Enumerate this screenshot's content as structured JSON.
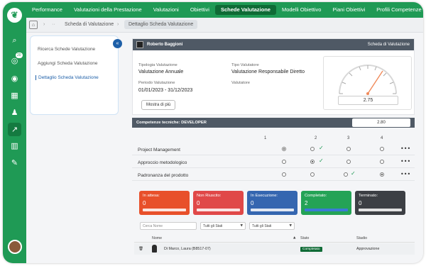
{
  "nav": {
    "items": [
      "Performance",
      "Valutazioni della Prestazione",
      "Valutazioni",
      "Obiettivi",
      "Schede Valutazione",
      "Modelli Obiettivo",
      "Piani Obiettivi",
      "Profili Competenze"
    ],
    "active_index": 4
  },
  "rail": {
    "icons": [
      "home-icon",
      "search-icon",
      "notifications-icon",
      "target-icon",
      "calendar-icon",
      "users-icon",
      "chart-icon",
      "org-icon",
      "tools-icon"
    ],
    "badge": "20"
  },
  "breadcrumb": {
    "item1": "Scheda di Valutazione",
    "item2": "Dettaglio Scheda Valutazione"
  },
  "sidebar": {
    "items": [
      "Ricerca Schede Valutazione",
      "Aggiungi Scheda Valutazione",
      "Dettaglio Scheda Valutazione"
    ],
    "selected_index": 2
  },
  "card": {
    "person": "Roberto Baggioni",
    "header_right": "Scheda di Valutazione",
    "tipologia_label": "Tipologia Valutazione",
    "tipologia_value": "Valutazione Annuale",
    "tipo_label": "Tipo Valutatore",
    "tipo_value": "Valutazione Responsabile Diretto",
    "periodo_label": "Periodo Valutazione",
    "periodo_value": "01/01/2023 - 31/12/2023",
    "valutatore_label": "Valutatore",
    "more_button": "Mostra di più",
    "gauge_value": "2.75"
  },
  "competenze": {
    "title": "Competenze tecniche: DEVELOPER",
    "score": "2.80",
    "columns": [
      "1",
      "2",
      "3",
      "4"
    ],
    "rows": [
      {
        "name": "Project Management",
        "selected": 1,
        "checked": 2
      },
      {
        "name": "Approccio metodologico",
        "selected": 2,
        "checked": 2
      },
      {
        "name": "Padronanza del prodotto",
        "selected": 4,
        "checked": 3
      }
    ]
  },
  "stats": [
    {
      "label": "In attesa:",
      "value": "0",
      "color": "#e8502a"
    },
    {
      "label": "Non Riuscito:",
      "value": "0",
      "color": "#e04848"
    },
    {
      "label": "In Esecuzione:",
      "value": "0",
      "color": "#3566b0"
    },
    {
      "label": "Completato:",
      "value": "2",
      "color": "#24a356"
    },
    {
      "label": "Terminato:",
      "value": "0",
      "color": "#3c3f44"
    }
  ],
  "filters": {
    "search_placeholder": "Cerca Nome",
    "filter1": "Tutti gli Stati",
    "filter2": "Tutti gli Stati"
  },
  "table": {
    "headers": [
      "Nome",
      "Stato",
      "Stadio"
    ],
    "rows": [
      {
        "nome": "Di Marco, Laura (B8517-07)",
        "stato": "Completato",
        "stadio": "Approvazione"
      }
    ]
  }
}
